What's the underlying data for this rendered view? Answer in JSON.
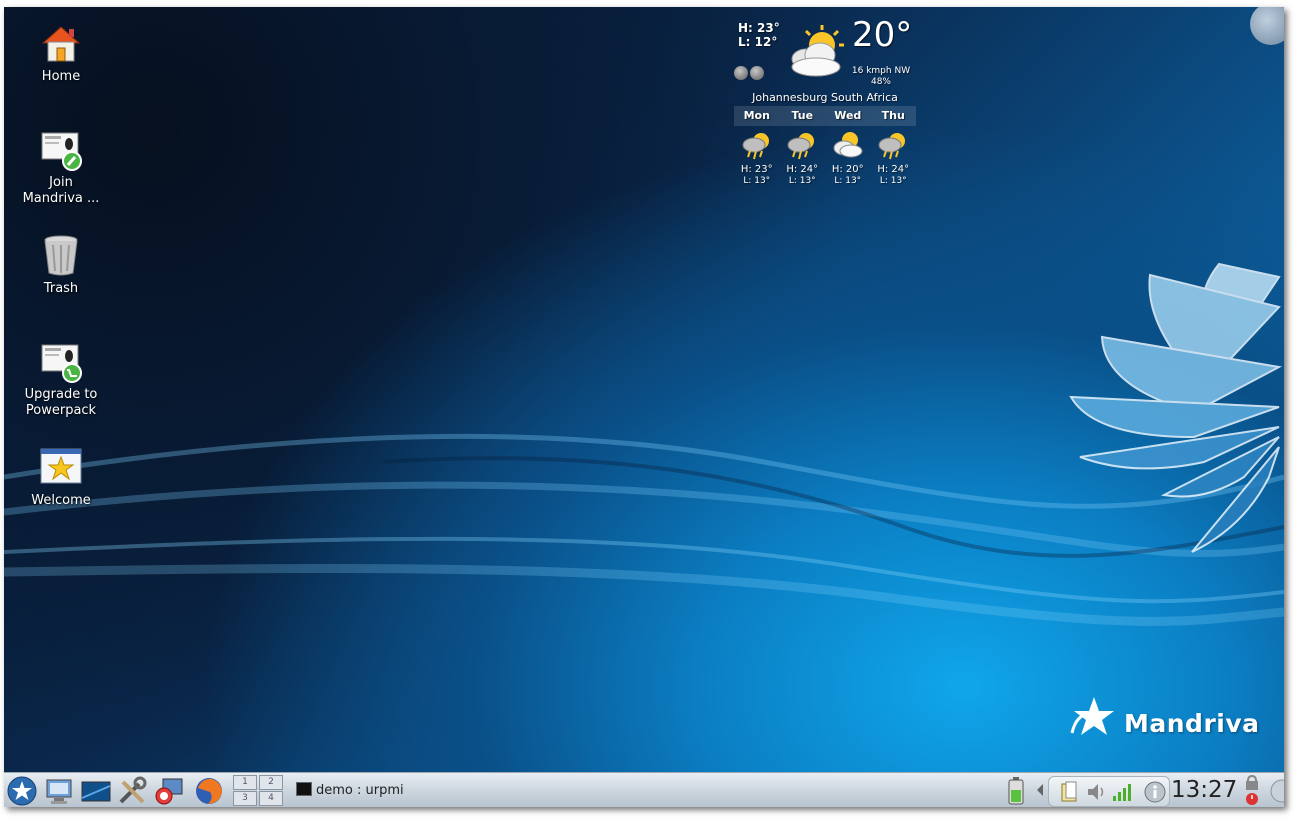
{
  "desktop": {
    "icons": [
      {
        "label": "Home",
        "icon": "home-icon"
      },
      {
        "label": "Join\nMandriva ...",
        "icon": "join-mandriva-icon"
      },
      {
        "label": "Trash",
        "icon": "trash-icon"
      },
      {
        "label": "Upgrade to\nPowerpack",
        "icon": "upgrade-icon"
      },
      {
        "label": "Welcome",
        "icon": "welcome-icon"
      }
    ],
    "logo_text": "Mandriva"
  },
  "weather": {
    "high": "H: 23°",
    "low": "L: 12°",
    "current_temp": "20°",
    "wind": "16 kmph NW",
    "humidity": "48%",
    "location": "Johannesburg South Africa",
    "forecast": [
      {
        "day": "Mon",
        "high": "H: 23°",
        "low": "L: 13°",
        "icon": "thunderstorm-sun-icon"
      },
      {
        "day": "Tue",
        "high": "H: 24°",
        "low": "L: 13°",
        "icon": "thunderstorm-sun-icon"
      },
      {
        "day": "Wed",
        "high": "H: 20°",
        "low": "L: 13°",
        "icon": "cloudy-sun-icon"
      },
      {
        "day": "Thu",
        "high": "H: 24°",
        "low": "L: 13°",
        "icon": "thunderstorm-sun-icon"
      }
    ]
  },
  "taskbar": {
    "pager": [
      "1",
      "2",
      "3",
      "4"
    ],
    "task_label": "demo : urpmi",
    "clock": "13:27"
  }
}
